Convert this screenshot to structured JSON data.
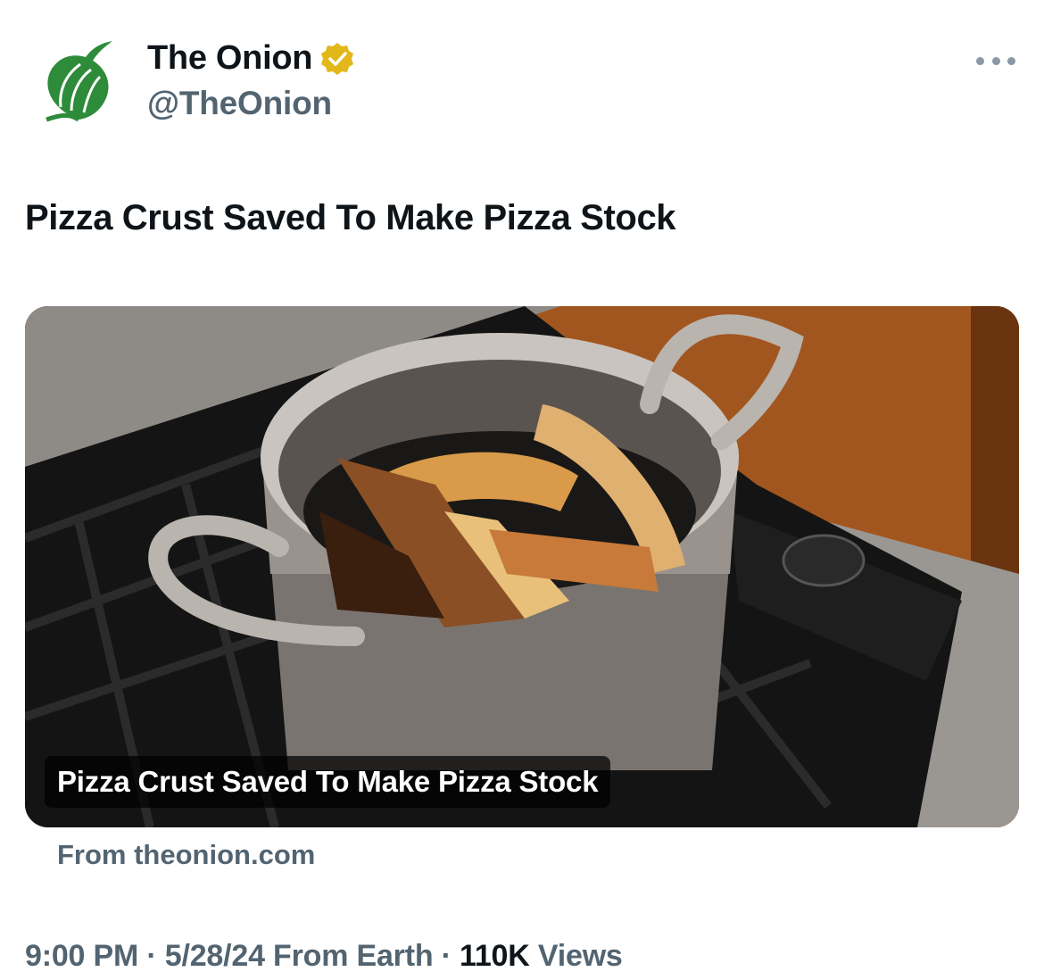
{
  "author": {
    "display_name": "The Onion",
    "handle": "@TheOnion",
    "verified": true,
    "avatar_icon": "onion-logo-icon",
    "brand_color": "#2e8b3a"
  },
  "tweet": {
    "text": "Pizza Crust Saved To Make Pizza Stock"
  },
  "link_card": {
    "image_description_icon": "article-image",
    "caption": "Pizza Crust Saved To Make Pizza Stock",
    "source": "From theonion.com"
  },
  "meta": {
    "time": "9:00 PM",
    "sep1": " · ",
    "date": "5/28/24",
    "location": " From Earth",
    "sep2": " · ",
    "views_count": "110K",
    "views_label": " Views"
  },
  "colors": {
    "text_primary": "#0f1419",
    "text_secondary": "#536471",
    "verified_gold": "#e2b719"
  }
}
